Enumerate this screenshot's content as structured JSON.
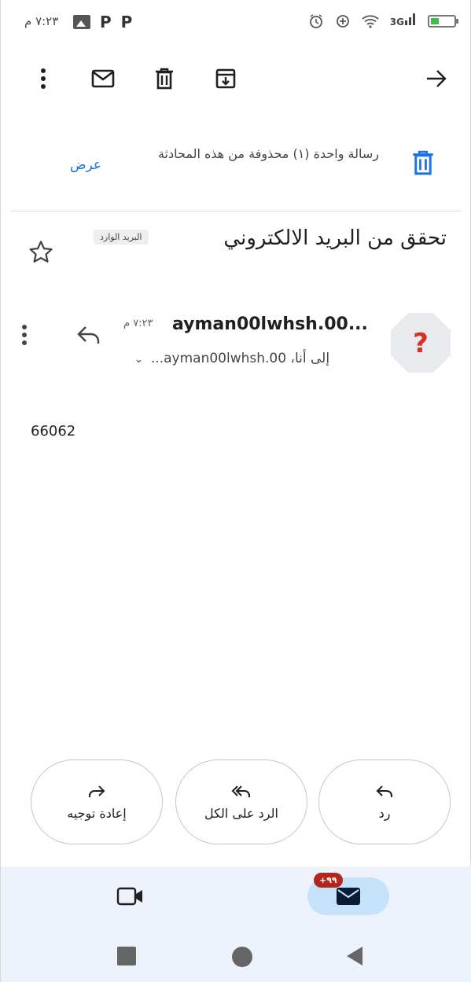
{
  "status_bar": {
    "time": "٧:٢٣ م",
    "left_icons": [
      "image-icon",
      "p-app-icon",
      "p-app-icon"
    ],
    "right_icons": [
      "alarm-icon",
      "data-saver-icon",
      "wifi-icon",
      "signal-3g-icon",
      "battery-icon"
    ],
    "network_label": "3G"
  },
  "toolbar": {
    "icons": [
      "more-vert-icon",
      "mail-unread-icon",
      "delete-icon",
      "archive-icon",
      "arrow-forward-icon"
    ]
  },
  "deleted_notice": {
    "text": "رسالة واحدة (١) محذوفة من هذه المحادثة",
    "action_label": "عرض"
  },
  "subject": {
    "text": "تحقق من البريد الالكتروني",
    "label_chip": "البريد الوارد"
  },
  "message": {
    "avatar_glyph": "?",
    "sender": "ayman00lwhsh.00...",
    "time": "٧:٢٣ م",
    "recipient": "إلى أنا، ayman00lwhsh.00...",
    "body": "66062"
  },
  "actions": {
    "reply": "رد",
    "reply_all": "الرد على الكل",
    "forward": "إعادة توجيه"
  },
  "bottom_nav": {
    "mail_badge": "٩٩+",
    "items": [
      "mail-icon",
      "video-icon"
    ]
  },
  "colors": {
    "accent_blue": "#1a73e8",
    "avatar_bg": "#e8eaed",
    "avatar_glyph": "#d93025",
    "badge_red": "#b3261e",
    "nav_bg": "#eef3fb",
    "mail_pill": "#c4e3fb"
  }
}
